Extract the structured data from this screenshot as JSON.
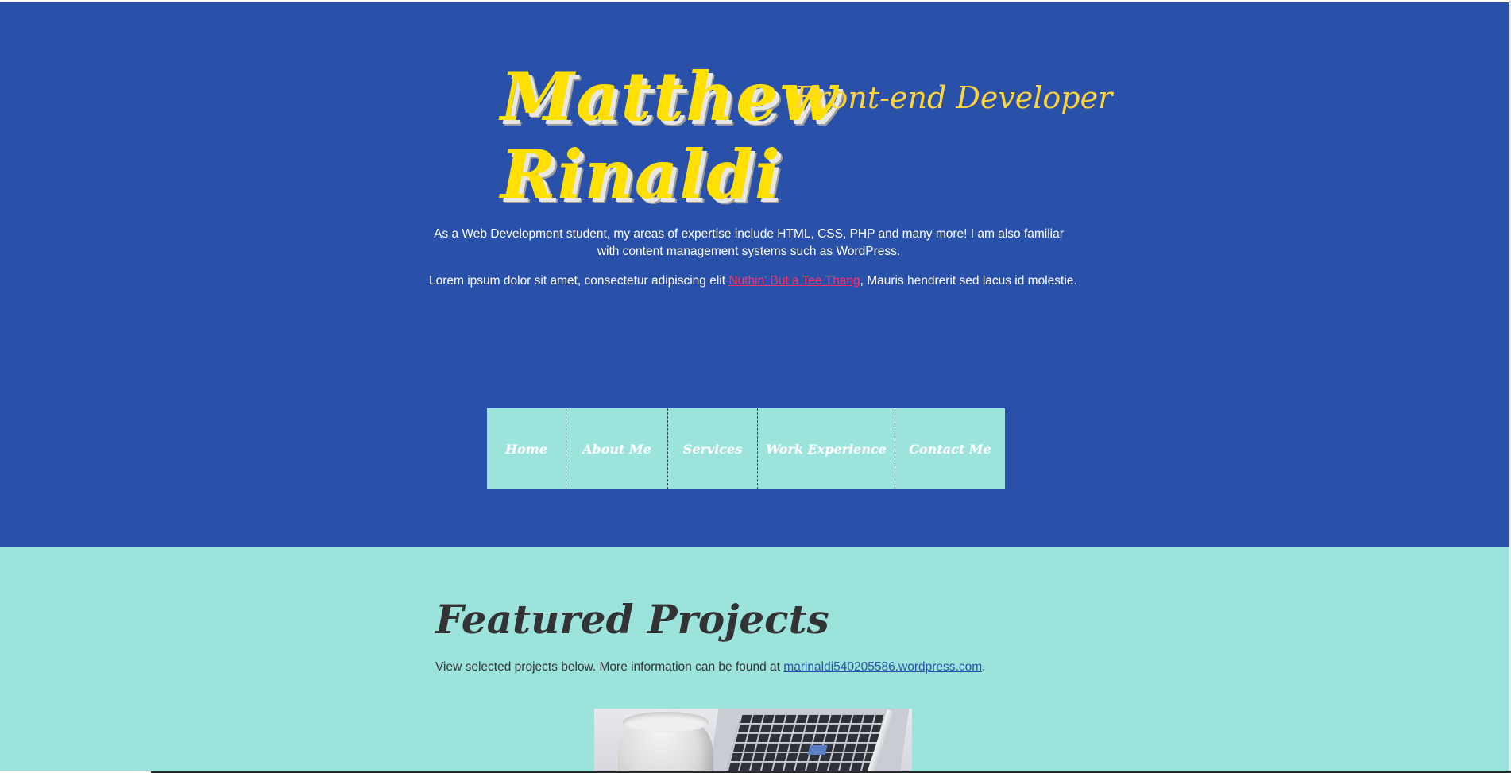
{
  "hero": {
    "name": "Matthew Rinaldi",
    "role": "Front-end Developer",
    "intro": "As a Web Development student, my areas of expertise include HTML, CSS, PHP and many more! I am also familiar with content management systems such as WordPress.",
    "lorem_before": "Lorem ipsum dolor sit amet, consectetur adipiscing elit ",
    "lorem_link": "Nuthin' But a Tee Thang",
    "lorem_after": ", Mauris hendrerit sed lacus id molestie."
  },
  "nav": {
    "items": [
      {
        "label": "Home"
      },
      {
        "label": "About Me"
      },
      {
        "label": "Services"
      },
      {
        "label": "Work Experience"
      },
      {
        "label": "Contact Me"
      }
    ]
  },
  "projects": {
    "title": "Featured Projects",
    "desc_before": "View selected projects below. More information can be found at ",
    "desc_link": "marinaldi540205586.wordpress.com",
    "desc_after": "."
  },
  "colors": {
    "hero_bg": "#2a51a9",
    "accent_yellow": "#ffe000",
    "teal": "#9ce3dc",
    "link_pink": "#ff2d6e",
    "text_dark": "#333333"
  }
}
